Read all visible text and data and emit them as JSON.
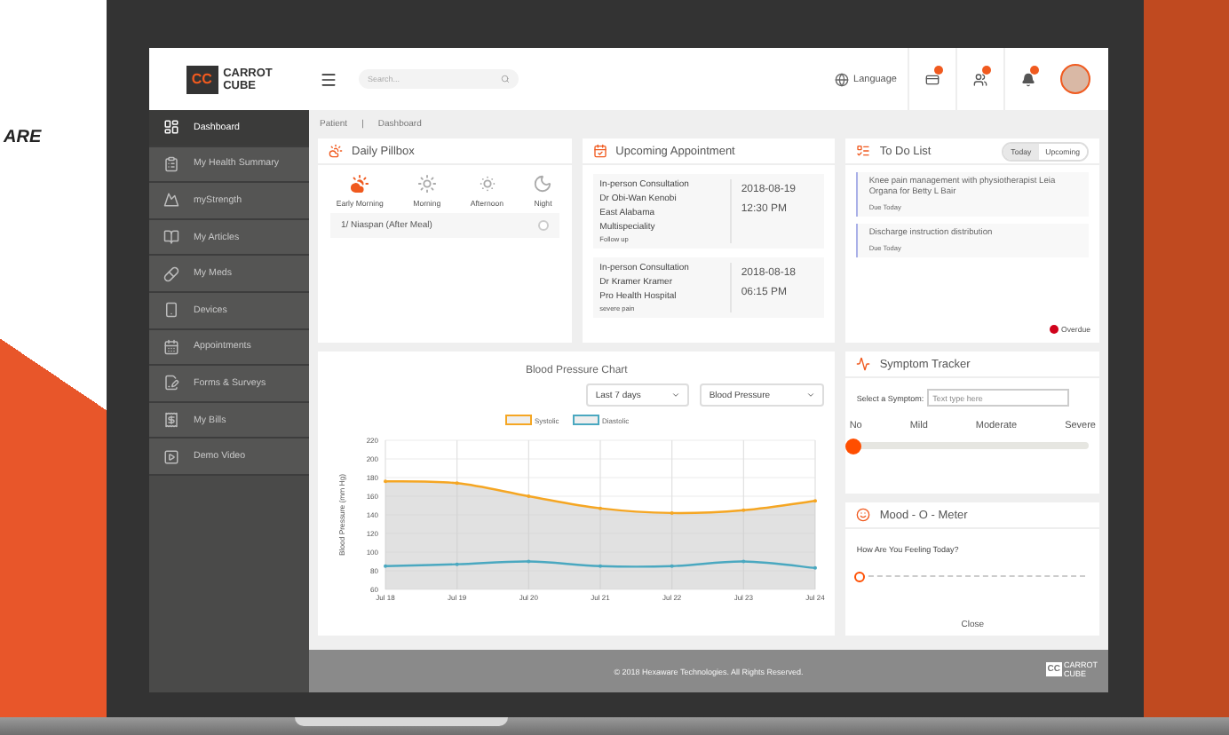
{
  "backdrop": {
    "text": "ARE"
  },
  "header": {
    "logo": {
      "mark": "CC",
      "line_1": "CARROT",
      "line_2": "CUBE"
    },
    "search": {
      "placeholder": "Search..."
    },
    "language": "Language"
  },
  "sidebar": {
    "items": [
      {
        "label": "Dashboard",
        "selected": true
      },
      {
        "label": "My Health Summary",
        "selected": false
      },
      {
        "label": "myStrength",
        "selected": false
      },
      {
        "label": "My Articles",
        "selected": false
      },
      {
        "label": "My Meds",
        "selected": false
      },
      {
        "label": "Devices",
        "selected": false
      },
      {
        "label": "Appointments",
        "selected": false
      },
      {
        "label": "Forms & Surveys",
        "selected": false
      },
      {
        "label": "My Bills",
        "selected": false
      },
      {
        "label": "Demo Video",
        "selected": false
      }
    ]
  },
  "breadcrumb": {
    "items": [
      "Patient",
      "Dashboard"
    ],
    "separator": "|"
  },
  "pillbox": {
    "title": "Daily Pillbox",
    "times": [
      {
        "label": "Early Morning",
        "selected": true
      },
      {
        "label": "Morning",
        "selected": false
      },
      {
        "label": "Afternoon",
        "selected": false
      },
      {
        "label": "Night",
        "selected": false
      }
    ],
    "meds": [
      {
        "name": "1/ Niaspan (After Meal)",
        "checked": false
      }
    ]
  },
  "appointments": {
    "title": "Upcoming Appointment",
    "items": [
      {
        "type": "In-person Consultation",
        "lines": [
          "Dr Obi-Wan Kenobi",
          "East Alabama",
          "Multispeciality"
        ],
        "note": "Follow up",
        "date": "2018-08-19",
        "time": "12:30 PM"
      },
      {
        "type": "In-person Consultation",
        "lines": [
          "Dr Kramer Kramer",
          "Pro Health Hospital"
        ],
        "note": "severe pain",
        "date": "2018-08-18",
        "time": "06:15 PM"
      }
    ]
  },
  "todo": {
    "title": "To Do List",
    "tabs": [
      {
        "label": "Today",
        "selected": true
      },
      {
        "label": "Upcoming",
        "selected": false
      }
    ],
    "items": [
      {
        "text": "Knee pain management with physiotherapist Leia Organa for Betty L Bair",
        "due": "Due Today"
      },
      {
        "text": "Discharge instruction distribution",
        "due": "Due Today"
      }
    ],
    "legend": {
      "label": "Overdue",
      "color": "#d0021b"
    }
  },
  "bp_chart": {
    "range_select": "Last 7 days",
    "metric_select": "Blood Pressure",
    "chart_data": {
      "type": "line",
      "grid": true,
      "legend": true,
      "title": "Blood Pressure Chart",
      "ylabel": "Blood Pressure (mm Hg)",
      "categories": [
        "Jul 18",
        "Jul 19",
        "Jul 20",
        "Jul 21",
        "Jul 22",
        "Jul 23",
        "Jul 24"
      ],
      "ylim": [
        60,
        220
      ],
      "yticks": [
        60,
        80,
        100,
        120,
        140,
        160,
        180,
        200,
        220
      ],
      "series": [
        {
          "name": "Systolic",
          "color": "#f5a623",
          "type": "area",
          "values": [
            176,
            174,
            160,
            147,
            142,
            145,
            155
          ]
        },
        {
          "name": "Diastolic",
          "color": "#4aa8c0",
          "type": "line",
          "values": [
            85,
            87,
            90,
            85,
            85,
            90,
            83
          ]
        }
      ]
    }
  },
  "symptom_tracker": {
    "title": "Symptom Tracker",
    "field_label": "Select a Symptom:",
    "placeholder": "Text type here",
    "scale": [
      "No",
      "Mild",
      "Moderate",
      "Severe"
    ],
    "level": 0
  },
  "mood_meter": {
    "title": "Mood - O - Meter",
    "question": "How Are You Feeling Today?",
    "level": 0,
    "close": "Close"
  },
  "footer": {
    "copyright": "© 2018 Hexaware Technologies. All Rights Reserved.",
    "logo": {
      "mark": "CC",
      "line_1": "CARROT",
      "line_2": "CUBE"
    }
  }
}
